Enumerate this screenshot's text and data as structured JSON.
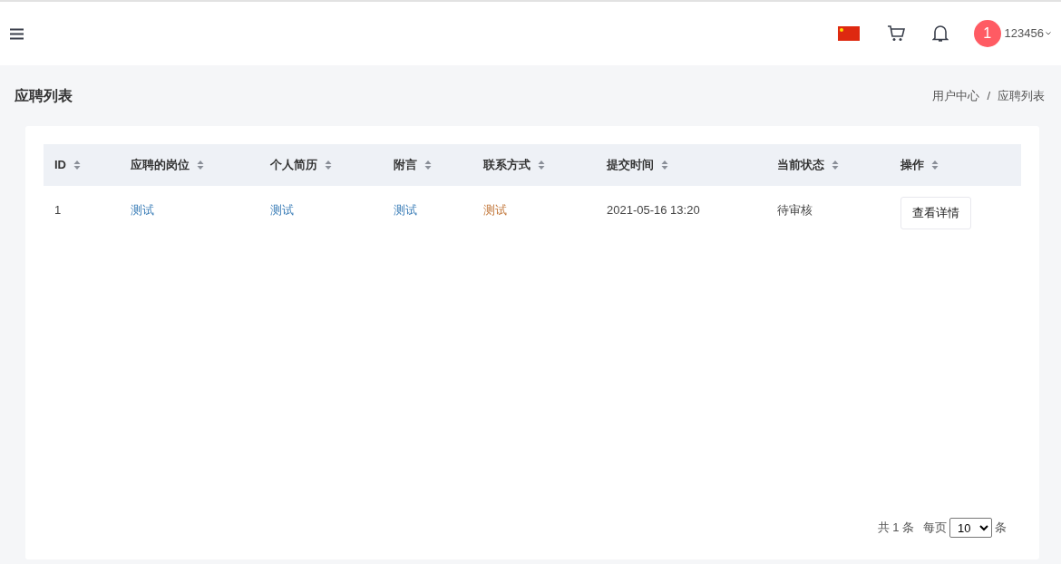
{
  "header": {
    "user": {
      "badge": "1",
      "name": "123456"
    }
  },
  "page": {
    "title": "应聘列表",
    "breadcrumb": {
      "items": [
        "用户中心",
        "应聘列表"
      ],
      "separator": "/"
    }
  },
  "table": {
    "columns": [
      "ID",
      "应聘的岗位",
      "个人简历",
      "附言",
      "联系方式",
      "提交时间",
      "当前状态",
      "操作"
    ],
    "rows": [
      {
        "cells": [
          {
            "text": "1",
            "kind": "text"
          },
          {
            "text": "测试",
            "kind": "link",
            "color": "#3d7fb8"
          },
          {
            "text": "测试",
            "kind": "link",
            "color": "#3d7fb8"
          },
          {
            "text": "测试",
            "kind": "link",
            "color": "#3d7fb8"
          },
          {
            "text": "测试",
            "kind": "link",
            "color": "#c2773a"
          },
          {
            "text": "2021-05-16 13:20",
            "kind": "text"
          },
          {
            "text": "待审核",
            "kind": "text"
          },
          {
            "text": "查看详情",
            "kind": "button"
          }
        ]
      }
    ]
  },
  "pagination": {
    "total": "共 1 条",
    "per_page_label": "每页",
    "per_page": "10",
    "unit": "条"
  }
}
